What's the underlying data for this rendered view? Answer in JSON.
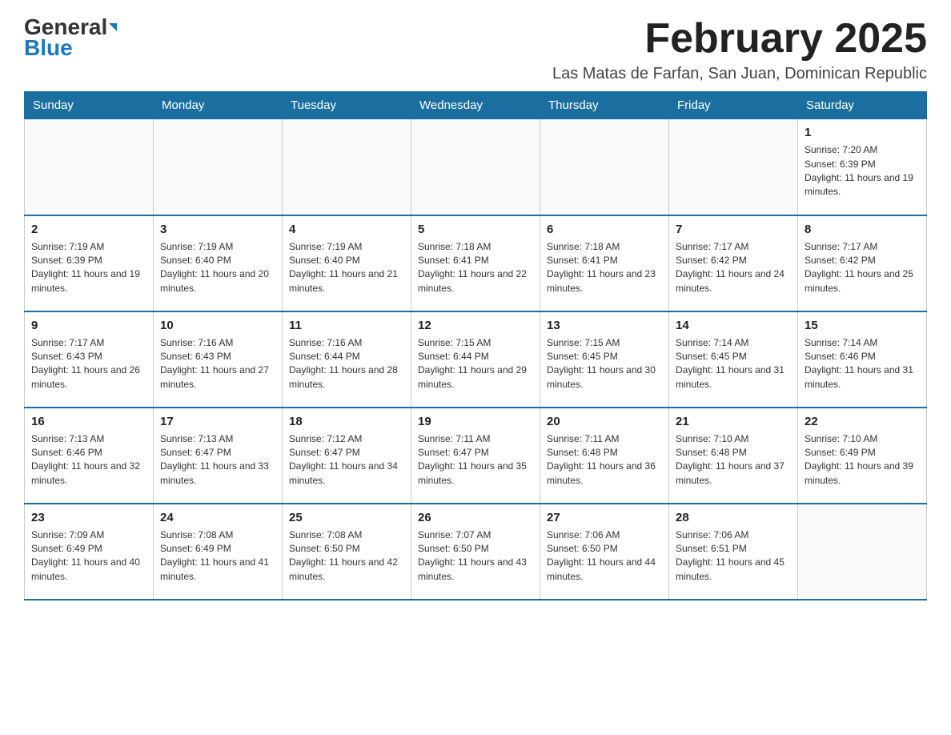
{
  "logo": {
    "text_general": "General",
    "text_blue": "Blue"
  },
  "title": "February 2025",
  "subtitle": "Las Matas de Farfan, San Juan, Dominican Republic",
  "weekdays": [
    "Sunday",
    "Monday",
    "Tuesday",
    "Wednesday",
    "Thursday",
    "Friday",
    "Saturday"
  ],
  "weeks": [
    [
      {
        "day": "",
        "sunrise": "",
        "sunset": "",
        "daylight": ""
      },
      {
        "day": "",
        "sunrise": "",
        "sunset": "",
        "daylight": ""
      },
      {
        "day": "",
        "sunrise": "",
        "sunset": "",
        "daylight": ""
      },
      {
        "day": "",
        "sunrise": "",
        "sunset": "",
        "daylight": ""
      },
      {
        "day": "",
        "sunrise": "",
        "sunset": "",
        "daylight": ""
      },
      {
        "day": "",
        "sunrise": "",
        "sunset": "",
        "daylight": ""
      },
      {
        "day": "1",
        "sunrise": "Sunrise: 7:20 AM",
        "sunset": "Sunset: 6:39 PM",
        "daylight": "Daylight: 11 hours and 19 minutes."
      }
    ],
    [
      {
        "day": "2",
        "sunrise": "Sunrise: 7:19 AM",
        "sunset": "Sunset: 6:39 PM",
        "daylight": "Daylight: 11 hours and 19 minutes."
      },
      {
        "day": "3",
        "sunrise": "Sunrise: 7:19 AM",
        "sunset": "Sunset: 6:40 PM",
        "daylight": "Daylight: 11 hours and 20 minutes."
      },
      {
        "day": "4",
        "sunrise": "Sunrise: 7:19 AM",
        "sunset": "Sunset: 6:40 PM",
        "daylight": "Daylight: 11 hours and 21 minutes."
      },
      {
        "day": "5",
        "sunrise": "Sunrise: 7:18 AM",
        "sunset": "Sunset: 6:41 PM",
        "daylight": "Daylight: 11 hours and 22 minutes."
      },
      {
        "day": "6",
        "sunrise": "Sunrise: 7:18 AM",
        "sunset": "Sunset: 6:41 PM",
        "daylight": "Daylight: 11 hours and 23 minutes."
      },
      {
        "day": "7",
        "sunrise": "Sunrise: 7:17 AM",
        "sunset": "Sunset: 6:42 PM",
        "daylight": "Daylight: 11 hours and 24 minutes."
      },
      {
        "day": "8",
        "sunrise": "Sunrise: 7:17 AM",
        "sunset": "Sunset: 6:42 PM",
        "daylight": "Daylight: 11 hours and 25 minutes."
      }
    ],
    [
      {
        "day": "9",
        "sunrise": "Sunrise: 7:17 AM",
        "sunset": "Sunset: 6:43 PM",
        "daylight": "Daylight: 11 hours and 26 minutes."
      },
      {
        "day": "10",
        "sunrise": "Sunrise: 7:16 AM",
        "sunset": "Sunset: 6:43 PM",
        "daylight": "Daylight: 11 hours and 27 minutes."
      },
      {
        "day": "11",
        "sunrise": "Sunrise: 7:16 AM",
        "sunset": "Sunset: 6:44 PM",
        "daylight": "Daylight: 11 hours and 28 minutes."
      },
      {
        "day": "12",
        "sunrise": "Sunrise: 7:15 AM",
        "sunset": "Sunset: 6:44 PM",
        "daylight": "Daylight: 11 hours and 29 minutes."
      },
      {
        "day": "13",
        "sunrise": "Sunrise: 7:15 AM",
        "sunset": "Sunset: 6:45 PM",
        "daylight": "Daylight: 11 hours and 30 minutes."
      },
      {
        "day": "14",
        "sunrise": "Sunrise: 7:14 AM",
        "sunset": "Sunset: 6:45 PM",
        "daylight": "Daylight: 11 hours and 31 minutes."
      },
      {
        "day": "15",
        "sunrise": "Sunrise: 7:14 AM",
        "sunset": "Sunset: 6:46 PM",
        "daylight": "Daylight: 11 hours and 31 minutes."
      }
    ],
    [
      {
        "day": "16",
        "sunrise": "Sunrise: 7:13 AM",
        "sunset": "Sunset: 6:46 PM",
        "daylight": "Daylight: 11 hours and 32 minutes."
      },
      {
        "day": "17",
        "sunrise": "Sunrise: 7:13 AM",
        "sunset": "Sunset: 6:47 PM",
        "daylight": "Daylight: 11 hours and 33 minutes."
      },
      {
        "day": "18",
        "sunrise": "Sunrise: 7:12 AM",
        "sunset": "Sunset: 6:47 PM",
        "daylight": "Daylight: 11 hours and 34 minutes."
      },
      {
        "day": "19",
        "sunrise": "Sunrise: 7:11 AM",
        "sunset": "Sunset: 6:47 PM",
        "daylight": "Daylight: 11 hours and 35 minutes."
      },
      {
        "day": "20",
        "sunrise": "Sunrise: 7:11 AM",
        "sunset": "Sunset: 6:48 PM",
        "daylight": "Daylight: 11 hours and 36 minutes."
      },
      {
        "day": "21",
        "sunrise": "Sunrise: 7:10 AM",
        "sunset": "Sunset: 6:48 PM",
        "daylight": "Daylight: 11 hours and 37 minutes."
      },
      {
        "day": "22",
        "sunrise": "Sunrise: 7:10 AM",
        "sunset": "Sunset: 6:49 PM",
        "daylight": "Daylight: 11 hours and 39 minutes."
      }
    ],
    [
      {
        "day": "23",
        "sunrise": "Sunrise: 7:09 AM",
        "sunset": "Sunset: 6:49 PM",
        "daylight": "Daylight: 11 hours and 40 minutes."
      },
      {
        "day": "24",
        "sunrise": "Sunrise: 7:08 AM",
        "sunset": "Sunset: 6:49 PM",
        "daylight": "Daylight: 11 hours and 41 minutes."
      },
      {
        "day": "25",
        "sunrise": "Sunrise: 7:08 AM",
        "sunset": "Sunset: 6:50 PM",
        "daylight": "Daylight: 11 hours and 42 minutes."
      },
      {
        "day": "26",
        "sunrise": "Sunrise: 7:07 AM",
        "sunset": "Sunset: 6:50 PM",
        "daylight": "Daylight: 11 hours and 43 minutes."
      },
      {
        "day": "27",
        "sunrise": "Sunrise: 7:06 AM",
        "sunset": "Sunset: 6:50 PM",
        "daylight": "Daylight: 11 hours and 44 minutes."
      },
      {
        "day": "28",
        "sunrise": "Sunrise: 7:06 AM",
        "sunset": "Sunset: 6:51 PM",
        "daylight": "Daylight: 11 hours and 45 minutes."
      },
      {
        "day": "",
        "sunrise": "",
        "sunset": "",
        "daylight": ""
      }
    ]
  ]
}
